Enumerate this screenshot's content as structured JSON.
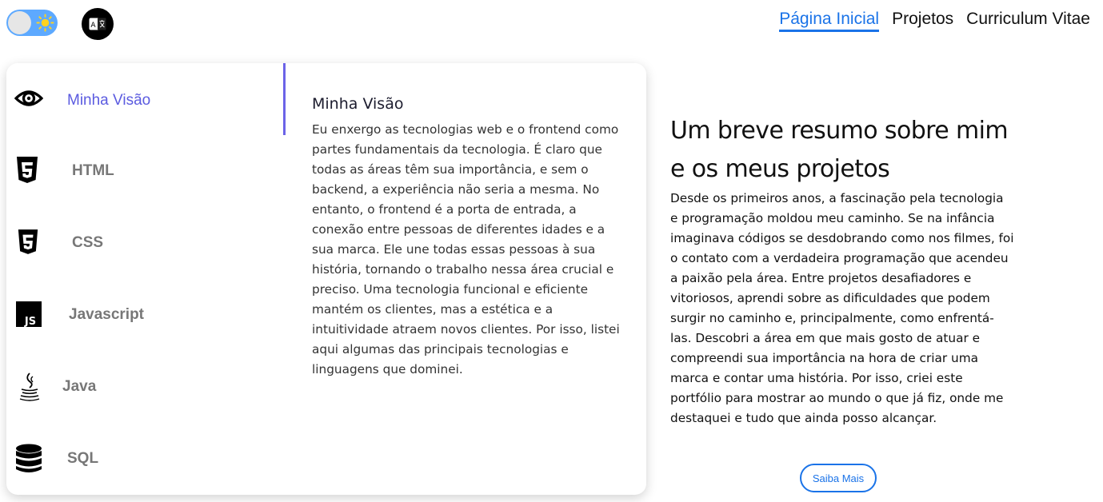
{
  "header": {
    "theme_toggle_icon": "sun-icon",
    "language_icon": "translate-icon",
    "nav": [
      {
        "label": "Página Inicial",
        "active": true
      },
      {
        "label": "Projetos",
        "active": false
      },
      {
        "label": "Curriculum Vitae",
        "active": false
      }
    ]
  },
  "tabs": [
    {
      "label": "Minha Visão",
      "icon": "eye-icon",
      "active": true
    },
    {
      "label": "HTML",
      "icon": "html5-icon",
      "active": false
    },
    {
      "label": "CSS",
      "icon": "css3-icon",
      "active": false
    },
    {
      "label": "Javascript",
      "icon": "javascript-icon",
      "active": false
    },
    {
      "label": "Java",
      "icon": "java-icon",
      "active": false
    },
    {
      "label": "SQL",
      "icon": "database-icon",
      "active": false
    }
  ],
  "panel": {
    "title": "Minha Visão",
    "text": "Eu enxergo as tecnologias web e o frontend como partes fundamentais da tecnologia. É claro que todas as áreas têm sua importância, e sem o backend, a experiência não seria a mesma. No entanto, o frontend é a porta de entrada, a conexão entre pessoas de diferentes idades e a sua marca. Ele une todas essas pessoas à sua história, tornando o trabalho nessa área crucial e preciso. Uma tecnologia funcional e eficiente mantém os clientes, mas a estética e a intuitividade atraem novos clientes. Por isso, listei aqui algumas das principais tecnologias e linguagens que dominei."
  },
  "resume": {
    "title": "Um breve resumo sobre mim e os meus projetos",
    "text": "Desde os primeiros anos, a fascinação pela tecnologia e programação moldou meu caminho. Se na infância imaginava códigos se desdobrando como nos filmes, foi o contato com a verdadeira programação que acendeu a paixão pela área. Entre projetos desafiadores e vitoriosos, aprendi sobre as dificuldades que podem surgir no caminho e, principalmente, como enfrentá-las. Descobri a área em que mais gosto de atuar e compreendi sua importância na hora de criar uma marca e contar uma história. Por isso, criei este portfólio para mostrar ao mundo o que já fiz, onde me destaquei e tudo que ainda posso alcançar.",
    "button_label": "Saiba Mais"
  },
  "colors": {
    "accent": "#1a73e8",
    "tab_active": "#5b5be0",
    "toggle": "#5da9ff"
  }
}
